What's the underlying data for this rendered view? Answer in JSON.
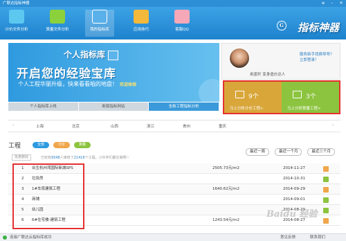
{
  "window": {
    "title": "广联达指标神器"
  },
  "nav": [
    {
      "label": "计价文件分析",
      "color": "#5cc8f0"
    },
    {
      "label": "算量文件分析",
      "color": "#8bd13c"
    },
    {
      "label": "我的指标库",
      "color": "#5ab1ea"
    },
    {
      "label": "应用技巧",
      "color": "#f4b83a"
    },
    {
      "label": "客服QQ",
      "color": "#f6a8b8"
    }
  ],
  "logo": {
    "text": "指标神器",
    "badge": "G"
  },
  "banner": {
    "line1": "个人指标库",
    "line2": "开启您的经验宝库",
    "line3": "个人工程华丽升级，快来看看咱的地盘！",
    "cta": "欢迎体验"
  },
  "banner_tabs": [
    "个人指标库上线",
    "新版指标网站",
    "全新工程指标分析"
  ],
  "profile": {
    "nickname": "用墨轩 变身造价达人",
    "new_text": "服务新手找换导导？立即登录！"
  },
  "stats": [
    {
      "count": "9个",
      "label": "马上分析计价工程>",
      "color": "#d9a63a"
    },
    {
      "count": "3个",
      "label": "马上分析算量工程>",
      "color": "#8cc43f"
    }
  ],
  "regions": [
    "上海",
    "北京",
    "山西",
    "浙江",
    "贵州",
    "重庆"
  ],
  "project": {
    "title": "工程",
    "filters": [
      {
        "label": "全部",
        "color": "#2d9ae0"
      },
      {
        "label": "计价",
        "color": "#f0a64b"
      },
      {
        "label": "算量",
        "color": "#8cc43f"
      }
    ],
    "delete_label": "批量删除",
    "hint_prefix": "已收有",
    "hint_count1": "9548",
    "hint_mid": "人审核了",
    "hint_count2": "21416",
    "hint_suffix": "个工程，小伙伴们都在做啊~",
    "periods": [
      "最近一周",
      "最近一个月",
      "最近三个月"
    ]
  },
  "rows": [
    {
      "no": "1",
      "name": "合生杭州湾国际新城SPS",
      "price": "2505.73元/m2",
      "date": "2014-11-27",
      "icon_color": "#f0a64b"
    },
    {
      "no": "2",
      "name": "垃圾房",
      "price": "",
      "date": "2014-10-31",
      "icon_color": "#8cc43f"
    },
    {
      "no": "3",
      "name": "1#车库建筑工程",
      "price": "1640.62元/m2",
      "date": "2014-09-29",
      "icon_color": "#f0a64b"
    },
    {
      "no": "4",
      "name": "商铺",
      "price": "",
      "date": "2014-09-01",
      "icon_color": "#8cc43f"
    },
    {
      "no": "5",
      "name": "幼儿园",
      "price": "",
      "date": "2014-08-29",
      "icon_color": "#8cc43f"
    },
    {
      "no": "6",
      "name": "6#住宅楼-建筑工程",
      "price": "1243.54元/m2",
      "date": "2014-08-27",
      "icon_color": "#f0a64b"
    }
  ],
  "status": {
    "message": "连接广联达云指标库成功",
    "feedback": "意见反馈",
    "contact": "联系我们"
  },
  "watermark": "Baidu 经验"
}
